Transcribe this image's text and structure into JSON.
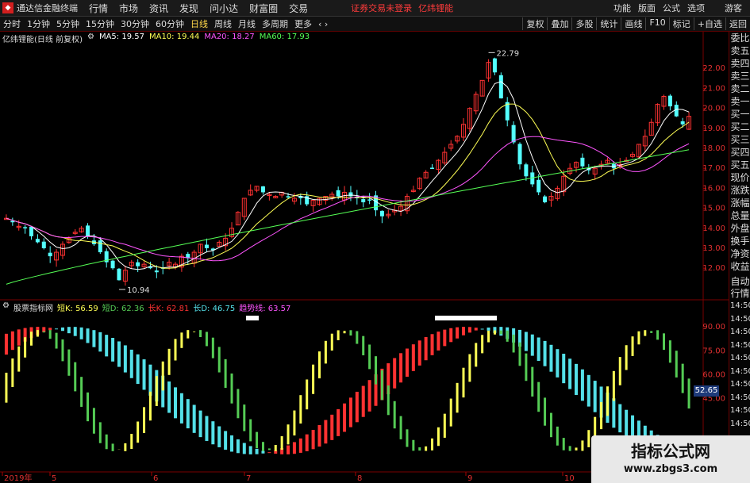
{
  "app_title": "通达信金融终端",
  "menu": [
    "行情",
    "市场",
    "资讯",
    "发现",
    "问小达",
    "财富圈",
    "交易"
  ],
  "notice": "证券交易未登录",
  "notice2": "亿纬锂能",
  "right_menu": [
    "功能",
    "版面",
    "公式",
    "选项"
  ],
  "guest": "游客",
  "periods": [
    "分时",
    "1分钟",
    "5分钟",
    "15分钟",
    "30分钟",
    "60分钟",
    "日线",
    "周线",
    "月线",
    "多周期",
    "更多"
  ],
  "active_period": "日线",
  "toolbar": [
    "复权",
    "叠加",
    "多股",
    "统计",
    "画线",
    "F10",
    "标记",
    "+自选",
    "返回"
  ],
  "main_legend": {
    "name": "亿纬锂能(日线 前复权)",
    "ma5": "MA5: 19.57",
    "ma10": "MA10: 19.44",
    "ma20": "MA20: 18.27",
    "ma60": "MA60: 17.93"
  },
  "ind_legend": {
    "name": "股票指标网",
    "dk": "短K: 56.59",
    "dd": "短D: 62.36",
    "ck": "长K: 62.81",
    "cd": "长D: 46.75",
    "trend": "趋势线: 63.57"
  },
  "price_axis": [
    "22.00",
    "21.00",
    "20.00",
    "19.00",
    "18.00",
    "17.00",
    "16.00",
    "15.00",
    "14.00",
    "13.00",
    "12.00"
  ],
  "ind_axis": [
    "90.00",
    "75.00",
    "60.00",
    "45.00"
  ],
  "date_labels": [
    "2019年",
    "5",
    "6",
    "7",
    "8",
    "9",
    "10"
  ],
  "high_label": "22.79",
  "low_label": "10.94",
  "ind_value": "52.65",
  "right_panel_top": [
    "委比",
    "卖五",
    "卖四",
    "卖三",
    "卖二",
    "卖一",
    "买一",
    "买二",
    "买三",
    "买四",
    "买五",
    "现价",
    "涨跌",
    "涨幅",
    "总量",
    "外盘",
    "换手",
    "净资",
    "收益"
  ],
  "right_panel_bottom_label": "自动行情",
  "right_panel_bottom": [
    "14:50",
    "14:50",
    "14:50",
    "14:50",
    "14:50",
    "14:50",
    "14:50",
    "14:50",
    "14:50",
    "14:50"
  ],
  "watermark": {
    "line1": "指标公式网",
    "line2": "www.zbgs3.com"
  },
  "colors": {
    "up": "#ff3232",
    "down": "#54ffff",
    "ma5": "#ffffff",
    "ma10": "#ffff55",
    "ma20": "#ff55ff",
    "ma60": "#55ff55",
    "short_k": "#ffff55",
    "short_d": "#55cc55",
    "long_k": "#ff3232",
    "long_d": "#54e0e8"
  },
  "chart_data": {
    "type": "candlestick",
    "title": "亿纬锂能(日线 前复权)",
    "y_range": [
      10.5,
      23.2
    ],
    "high": 22.79,
    "low": 10.94,
    "close_path": [
      14.5,
      14.3,
      14.1,
      14.0,
      13.6,
      13.3,
      13.0,
      12.6,
      12.8,
      13.2,
      13.5,
      13.8,
      14.0,
      13.6,
      13.2,
      12.8,
      12.3,
      12.0,
      11.4,
      11.9,
      12.3,
      12.1,
      12.2,
      12.0,
      11.8,
      12.0,
      12.3,
      12.2,
      12.6,
      12.5,
      12.8,
      13.2,
      13.0,
      12.9,
      13.3,
      13.5,
      14.0,
      14.8,
      15.5,
      15.9,
      16.1,
      15.8,
      15.7,
      15.6,
      15.8,
      15.6,
      15.5,
      15.5,
      15.2,
      15.4,
      15.5,
      15.6,
      15.7,
      15.6,
      15.8,
      15.6,
      15.5,
      15.3,
      15.4,
      14.9,
      14.6,
      14.7,
      14.9,
      15.1,
      15.6,
      15.9,
      16.5,
      16.8,
      17.0,
      17.4,
      17.8,
      18.2,
      18.6,
      19.2,
      20.0,
      20.7,
      21.4,
      22.3,
      21.8,
      20.5,
      19.4,
      18.3,
      17.2,
      16.6,
      16.2,
      15.8,
      15.3,
      15.6,
      16.0,
      16.6,
      17.0,
      17.3,
      17.1,
      16.9,
      17.0,
      17.2,
      17.4,
      17.0,
      17.2,
      17.4,
      17.7,
      18.2,
      18.6,
      19.3,
      20.2,
      20.6,
      20.1,
      19.6,
      19.2,
      19.6
    ],
    "ma5": 19.57,
    "ma10": 19.44,
    "ma20": 18.27,
    "ma60": 17.93,
    "indicator": {
      "y_range": [
        0,
        100
      ],
      "short_k": 56.59,
      "short_d": 62.36,
      "long_k": 62.81,
      "long_d": 46.75,
      "trend": 63.57
    }
  }
}
